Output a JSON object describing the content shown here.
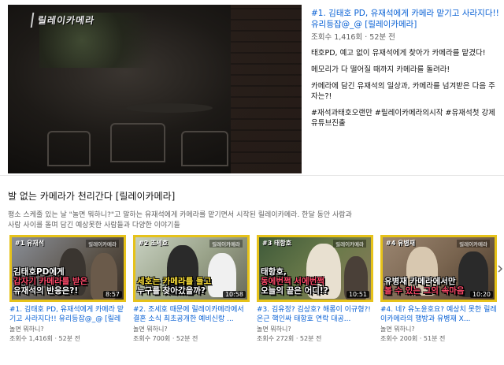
{
  "featured": {
    "overlay_logo": "릴레이카메라",
    "title": "#1. 김태호 PD, 유재석에게 카메라 맡기고 사라지다!! 유리등잡@_@ [릴레이카메라]",
    "views": "조회수 1,416회",
    "dot": "·",
    "age": "52분 전",
    "description": [
      "태호PD, 예고 없이 유재석에게 찾아가 카메라를 맡겼다!",
      "메모리가 다 떨어질 때까지 카메라를 돌려라!",
      "카메라에 담긴 유재석의 일상과, 카메라를 넘겨받은 다음 주자는?!",
      "#재석과태호오랜만 #릴레이카메라의시작 #유재석첫 강제유튜브진출"
    ]
  },
  "shelf": {
    "title": "발 없는 카메라가 천리간다 [릴레이카메라]",
    "description": "평소 스케줄 있는 날 \"놀면 뭐하니?\"고 말하는 유재석에게 카메라를 맡기면서 시작된 릴레이카메라. 한달 동안 사람과 사람 사이를 돌며 담긴 예상못한 사람들과 다양한 이야기들"
  },
  "videos": [
    {
      "tag": "#1 유재석",
      "brand": "릴레이카메라",
      "caption_lines": [
        "김태호PD에게",
        "갑자기 카메라를 받은",
        "유재석의 반응은?!"
      ],
      "duration": "8:57",
      "title": "#1. 김태호 PD, 유재석에게 카메라 맡기고 사라지다!! 유리등잡@_@ [릴레이카메라]",
      "channel": "놀면 뭐하니?",
      "views": "조회수 1,416회",
      "age": "52분 전"
    },
    {
      "tag": "#2 조세호",
      "brand": "릴레이카메라",
      "caption_lines": [
        "세호는 카메라를 들고",
        "누구를 찾아갔을까?"
      ],
      "duration": "10:58",
      "title": "#2. 조세호 때문에 릴레이카메라에서 결혼 소식 최초공개한 예비신랑 ...",
      "channel": "놀면 뭐하니?",
      "views": "조회수 700회",
      "age": "52분 전"
    },
    {
      "tag": "#3 태항호",
      "brand": "릴레이카메라",
      "caption_lines": [
        "태항호,",
        "동에번쩍 서에번쩍",
        "오늘의 끝은 어디!?"
      ],
      "duration": "10:51",
      "title": "#3. 김유정? 김상호? 해롱이 이규형?! 온근 핵인싸 태항호 연락 대공...",
      "channel": "놀면 뭐하니?",
      "views": "조회수 272회",
      "age": "52분 전"
    },
    {
      "tag": "#4 유병재",
      "brand": "릴레이카메라",
      "caption_lines": [
        "유병재 카메라에서만",
        "볼 수 있는 그의 속마음"
      ],
      "duration": "10:20",
      "title": "#4. 네? 유노윤호요? 예상치 못한 릴레이카메라의 행방과 유병재 X...",
      "channel": "놀면 뭐하니?",
      "views": "조회수 200회",
      "age": "51분 전"
    }
  ],
  "colors": {
    "link_blue": "#065fd4",
    "meta_gray": "#606060",
    "thumb_border_yellow": "#e6c21a"
  },
  "icons": {
    "next_arrow": "chevron-right-icon"
  }
}
